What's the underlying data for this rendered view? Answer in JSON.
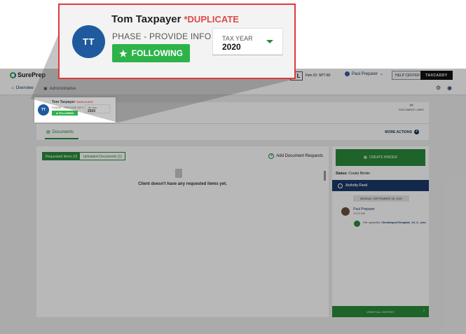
{
  "app": {
    "logo_text": "SurePrep",
    "firm_tag": "3 L",
    "firm_id": "Firm ID: SPT-80",
    "user_name": "Paul Preparer",
    "help_label": "HELP CENTER",
    "taxcaddy_label": "TAXCADDY"
  },
  "subnav": {
    "overview": "Overview",
    "administrative": "Administrative"
  },
  "client": {
    "initials": "TT",
    "name": "Tom Taxpayer",
    "duplicate": "*DUPLICATE",
    "phase": "PHASE - PROVIDE INFO",
    "following": "FOLLOWING",
    "tax_year_label": "TAX YEAR",
    "tax_year_value": "2020",
    "mini_tax_year_label": "Tax Year"
  },
  "document_links": "DOCUMENT LINKS",
  "documents_tab": "Documents",
  "more_actions": "MORE ACTIONS",
  "requests": {
    "tab_requested": "Requested Items (0)",
    "tab_uploaded": "Uploaded Documents (1)",
    "add_request": "Add Document Requests",
    "empty_text": "Client doesn't have any requested items yet."
  },
  "binder": {
    "create_label": "CREATE BINDER",
    "status_label": "Status:",
    "status_value": "Create Binder"
  },
  "feed": {
    "title": "Activity Feed",
    "date": "MONDAY, SEPTEMBER 20, 2021",
    "author": "Paul Preparer",
    "time": "10:22 AM",
    "file_prefix": "File uploaded:",
    "file_name": "ClientImportTemplate_V4_3_.xlsx",
    "view_history": "VIEW FULL HISTORY"
  },
  "colors": {
    "accent_green": "#2db34a",
    "avatar_blue": "#1f5a9e",
    "duplicate_red": "#e04848",
    "callout_border": "#e03a3a",
    "feed_header": "#1a3a6a"
  }
}
